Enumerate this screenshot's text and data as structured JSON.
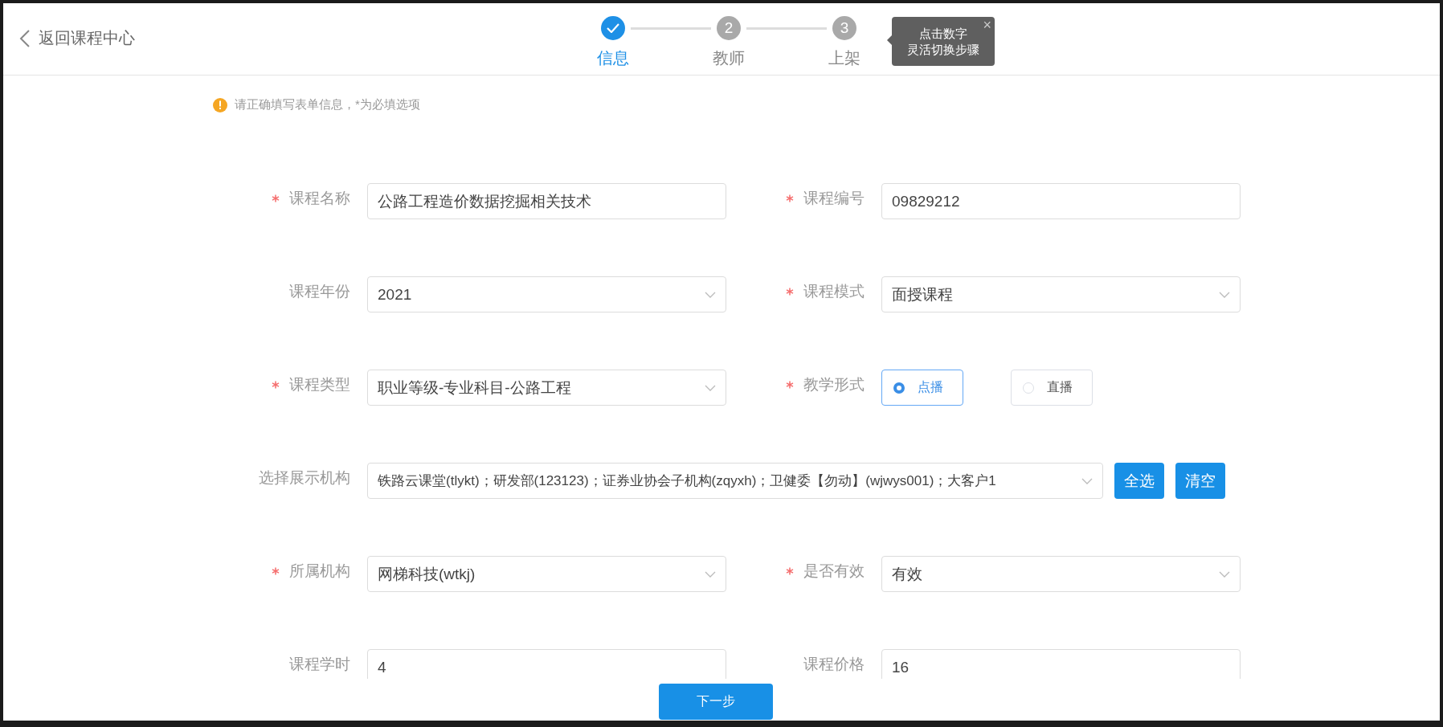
{
  "header": {
    "back_link": "返回课程中心"
  },
  "steps": [
    {
      "label": "信息",
      "selected": true,
      "done": true
    },
    {
      "number": "2",
      "label": "教师",
      "selected": false,
      "done": false
    },
    {
      "number": "3",
      "label": "上架",
      "selected": false,
      "done": false
    }
  ],
  "tooltip": {
    "lines": [
      "点击数字",
      "灵活切换步骤"
    ],
    "close": "×"
  },
  "notice": {
    "text": "请正确填写表单信息，*为必填选项"
  },
  "form_rows": [
    {
      "fields": [
        {
          "kind": "text",
          "label": "课程名称",
          "required": true,
          "value": "公路工程造价数据挖掘相关技术"
        },
        {
          "kind": "text",
          "label": "课程编号",
          "required": true,
          "value": "09829212"
        }
      ]
    },
    {
      "fields": [
        {
          "kind": "select",
          "label": "课程年份",
          "required": false,
          "value": "2021"
        },
        {
          "kind": "select",
          "label": "课程模式",
          "required": true,
          "value": "面授课程"
        }
      ]
    },
    {
      "fields": [
        {
          "kind": "select",
          "label": "课程类型",
          "required": true,
          "value": "职业等级-专业科目-公路工程"
        },
        {
          "kind": "radio",
          "label": "教学形式",
          "required": true,
          "options": [
            {
              "label": "点播",
              "selected": true
            },
            {
              "label": "直播",
              "selected": false
            }
          ]
        }
      ]
    },
    {
      "fields": [
        {
          "kind": "multiselect",
          "label": "选择展示机构",
          "required": false,
          "value": "铁路云课堂(tlykt)；研发部(123123)；证券业协会子机构(zqyxh)；卫健委【勿动】(wjwys001)；大客户1",
          "buttons": [
            "全选",
            "清空"
          ]
        }
      ]
    },
    {
      "fields": [
        {
          "kind": "select",
          "label": "所属机构",
          "required": true,
          "value": "网梯科技(wtkj)"
        },
        {
          "kind": "select",
          "label": "是否有效",
          "required": true,
          "value": "有效"
        }
      ]
    },
    {
      "fields": [
        {
          "kind": "text",
          "label": "课程学时",
          "required": false,
          "value": "4"
        },
        {
          "kind": "text",
          "label": "课程价格",
          "required": false,
          "value": "16"
        }
      ]
    }
  ],
  "footer": {
    "next_button": "下一步"
  }
}
